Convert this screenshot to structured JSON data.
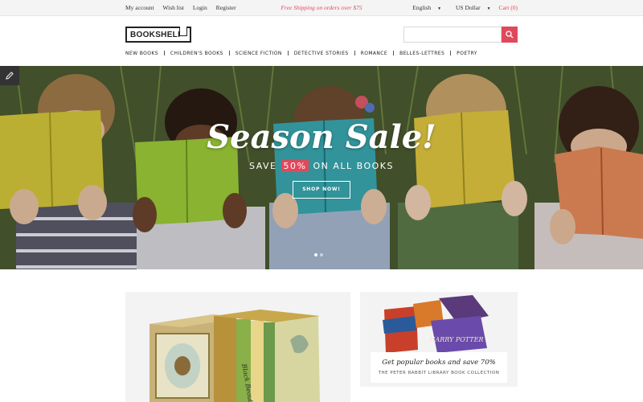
{
  "topbar": {
    "links": [
      "My account",
      "Wish list",
      "Login",
      "Register"
    ],
    "promo": "Free Shipping on orders over $75",
    "language": "English",
    "currency": "US Dollar",
    "cart": "Cart (0)"
  },
  "header": {
    "logo": "BOOKSHELF",
    "search_placeholder": ""
  },
  "nav": {
    "items": [
      "NEW BOOKS",
      "CHILDREN'S BOOKS",
      "SCIENCE FICTION",
      "DETECTIVE STORIES",
      "ROMANCE",
      "BELLES-LETTRES",
      "POETRY"
    ]
  },
  "hero": {
    "title": "Season Sale!",
    "sub_before": "SAVE ",
    "sub_pct": "50%",
    "sub_after": " ON ALL BOOKS",
    "button": "SHOP NOW!",
    "slides": 2,
    "active_slide": 1
  },
  "promo_banner": {
    "headline": "Get popular books and save 70%",
    "subline": "THE PETER RABBIT LIBRARY BOOK COLLECTION",
    "product_title": "HARRY POTTER"
  },
  "colors": {
    "accent": "#e0495c"
  }
}
